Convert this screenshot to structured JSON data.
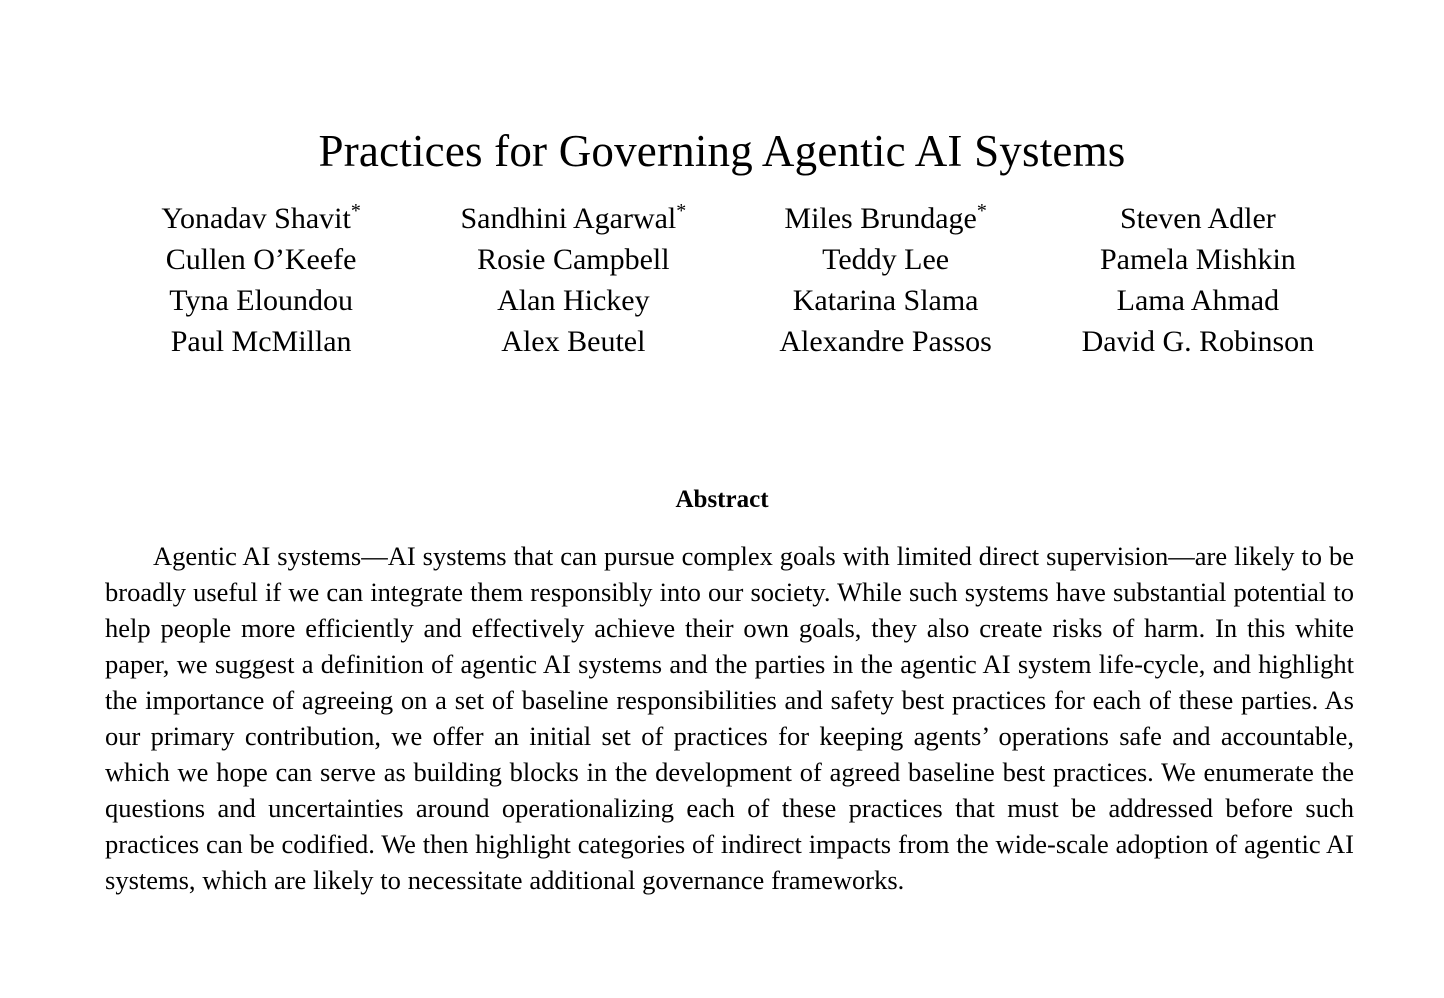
{
  "paper": {
    "title": "Practices for Governing Agentic AI Systems",
    "authors": {
      "rows": [
        [
          {
            "name": "Yonadav Shavit",
            "footnote": "*"
          },
          {
            "name": "Sandhini Agarwal",
            "footnote": "*"
          },
          {
            "name": "Miles Brundage",
            "footnote": "*"
          },
          {
            "name": "Steven Adler",
            "footnote": ""
          }
        ],
        [
          {
            "name": "Cullen O’Keefe",
            "footnote": ""
          },
          {
            "name": "Rosie Campbell",
            "footnote": ""
          },
          {
            "name": "Teddy Lee",
            "footnote": ""
          },
          {
            "name": "Pamela Mishkin",
            "footnote": ""
          }
        ],
        [
          {
            "name": "Tyna Eloundou",
            "footnote": ""
          },
          {
            "name": "Alan Hickey",
            "footnote": ""
          },
          {
            "name": "Katarina Slama",
            "footnote": ""
          },
          {
            "name": "Lama Ahmad",
            "footnote": ""
          }
        ],
        [
          {
            "name": "Paul McMillan",
            "footnote": ""
          },
          {
            "name": "Alex Beutel",
            "footnote": ""
          },
          {
            "name": "Alexandre Passos",
            "footnote": ""
          },
          {
            "name": "David G. Robinson",
            "footnote": ""
          }
        ]
      ]
    },
    "abstract": {
      "heading": "Abstract",
      "text": "Agentic AI systems—AI systems that can pursue complex goals with limited direct supervision—are likely to be broadly useful if we can integrate them responsibly into our society. While such systems have substantial potential to help people more efficiently and effectively achieve their own goals, they also create risks of harm. In this white paper, we suggest a definition of agentic AI systems and the parties in the agentic AI system life-cycle, and highlight the importance of agreeing on a set of baseline responsibilities and safety best practices for each of these parties. As our primary contribution, we offer an initial set of practices for keeping agents’ operations safe and accountable, which we hope can serve as building blocks in the development of agreed baseline best practices. We enumerate the questions and uncertainties around operationalizing each of these practices that must be addressed before such practices can be codified. We then highlight categories of indirect impacts from the wide-scale adoption of agentic AI systems, which are likely to necessitate additional governance frameworks."
    }
  },
  "colors": {
    "text": "#000000",
    "background": "#ffffff"
  }
}
